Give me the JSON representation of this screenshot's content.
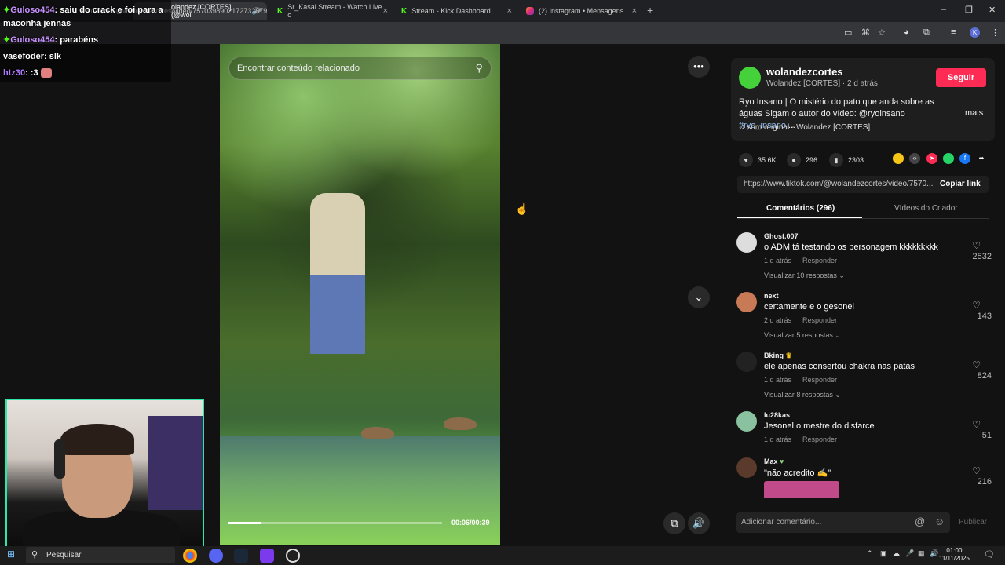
{
  "browser": {
    "tabs": [
      {
        "title": "olandez [CORTES] (@wol",
        "active": true
      },
      {
        "title": "Sr_Kasai Stream - Watch Live o"
      },
      {
        "title": "Stream - Kick Dashboard"
      },
      {
        "title": "(2) Instagram • Mensagens"
      }
    ],
    "url": "tiktok.com/@wolandezcortes/video/7570398902172732679",
    "profile_initial": "K"
  },
  "video": {
    "search_placeholder": "Encontrar conteúdo relacionado",
    "time": "00:06/00:39",
    "progress": 0.15
  },
  "creator": {
    "username": "wolandezcortes",
    "subtitle": "Wolandez [CORTES] · 2 d atrás",
    "follow_label": "Seguir",
    "description_text": "Ryo Insano | O mistério do pato que anda sobre as águas Sigam o autor do vídeo: @ryoinsano ",
    "hashtag": "#ryo_insano",
    "ellipsis": " ...",
    "more_label": "mais",
    "music": "som original - Wolandez [CORTES]",
    "brand_color": "#fe2c55"
  },
  "stats": {
    "likes": "35.6K",
    "comments": "296",
    "saves": "2303"
  },
  "link": {
    "url": "https://www.tiktok.com/@wolandezcortes/video/7570...",
    "copy_label": "Copiar link"
  },
  "tabs": {
    "comments": "Comentários (296)",
    "creator_videos": "Vídeos do Criador"
  },
  "comments": [
    {
      "user": "Ghost.007",
      "text": "o ADM tá testando os personagem kkkkkkkkk",
      "time": "1 d atrás",
      "reply": "Responder",
      "replies": "Visualizar 10 respostas",
      "likes": "2532"
    },
    {
      "user": "next",
      "text": "certamente e o gesonel",
      "time": "2 d atrás",
      "reply": "Responder",
      "replies": "Visualizar 5 respostas",
      "likes": "143"
    },
    {
      "user": "Bking",
      "text": "ele apenas consertou chakra nas patas",
      "time": "1 d atrás",
      "reply": "Responder",
      "replies": "Visualizar 8 respostas",
      "likes": "824"
    },
    {
      "user": "lu28kas",
      "text": "Jesonel o mestre do disfarce",
      "time": "1 d atrás",
      "reply": "Responder",
      "replies": "",
      "likes": "51"
    },
    {
      "user": "Max",
      "text": "\"não acredito ✍\"",
      "time": "",
      "reply": "",
      "replies": "",
      "likes": "216"
    }
  ],
  "comment_bar": {
    "placeholder": "Adicionar comentário...",
    "publish_label": "Publicar"
  },
  "chat": [
    {
      "user": "Guloso454",
      "msg": ": saiu do crack e foi para a"
    },
    {
      "user": "",
      "msg": "maconha jennas"
    },
    {
      "user": "Guloso454",
      "msg": ": parabéns"
    },
    {
      "user": "vasefoder",
      "msg": ": slk"
    },
    {
      "user": "htz30",
      "msg": ": :3"
    }
  ],
  "taskbar": {
    "search_label": "Pesquisar",
    "time": "01:00",
    "date": "11/11/2025"
  }
}
